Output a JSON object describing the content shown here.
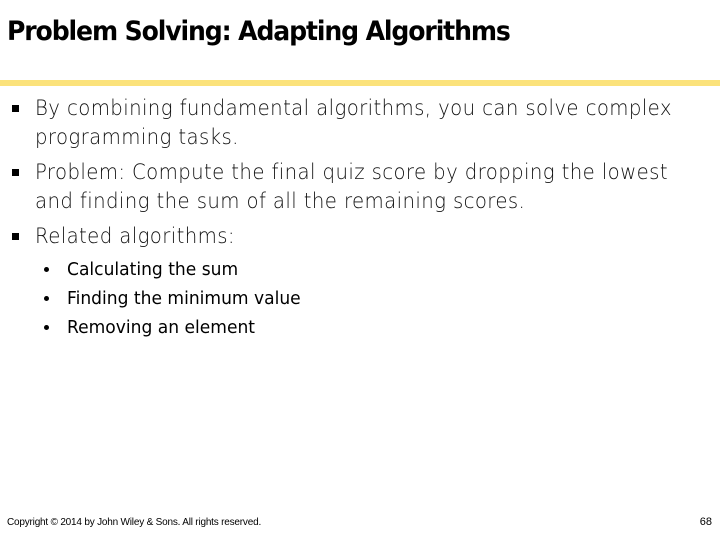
{
  "slide": {
    "title": "Problem Solving: Adapting Algorithms",
    "accent_color": "#fbe27b",
    "bullets": [
      {
        "text": "By combining fundamental algorithms, you can solve complex programming tasks."
      },
      {
        "text": "Problem: Compute the final quiz score by dropping the lowest and finding the sum of all the remaining scores."
      },
      {
        "text": "Related algorithms:"
      }
    ],
    "sub_bullets": [
      {
        "text": "Calculating the sum"
      },
      {
        "text": "Finding the minimum value"
      },
      {
        "text": "Removing an element"
      }
    ],
    "footer": {
      "copyright": "Copyright © 2014 by John Wiley & Sons.  All rights reserved.",
      "page_number": "68"
    }
  }
}
